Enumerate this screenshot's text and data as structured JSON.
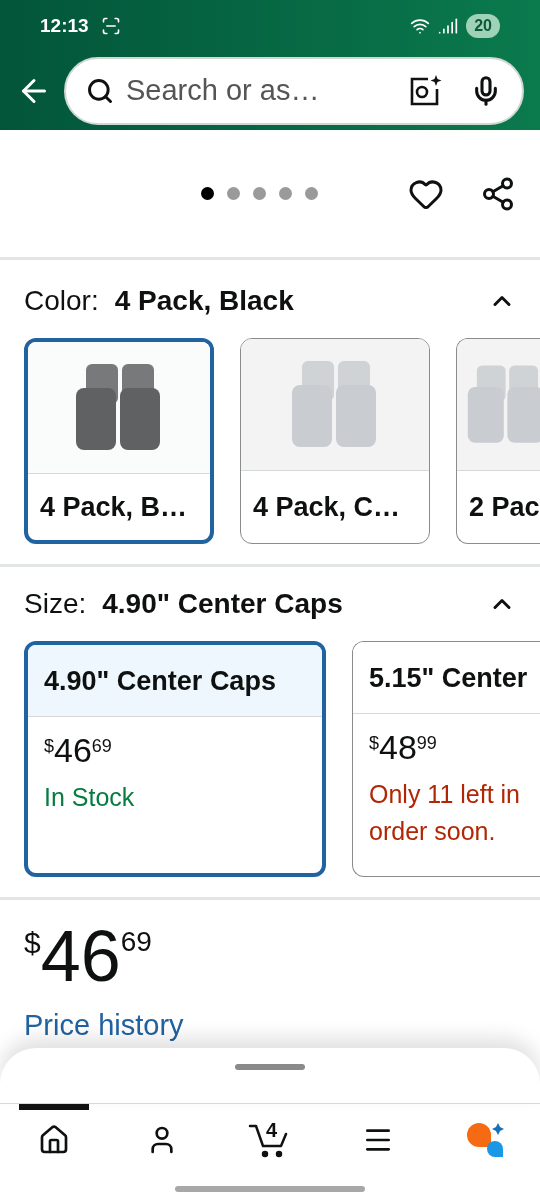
{
  "status_bar": {
    "time": "12:13",
    "battery": "20"
  },
  "search": {
    "placeholder": "Search or as…"
  },
  "carousel": {
    "dots": [
      {
        "selected": true
      },
      {
        "selected": false
      },
      {
        "selected": false
      },
      {
        "selected": false
      },
      {
        "selected": false
      }
    ]
  },
  "color": {
    "label": "Color:",
    "value": "4 Pack, Black",
    "expanded": true,
    "options": [
      {
        "label": "4 Pack, B…",
        "selected": true,
        "kind": "dark"
      },
      {
        "label": "4 Pack, C…",
        "selected": false,
        "kind": "chrome"
      },
      {
        "label": "2 Pac",
        "selected": false,
        "kind": "chrome"
      }
    ]
  },
  "size": {
    "label": "Size:",
    "value": "4.90\" Center Caps",
    "expanded": true,
    "options": [
      {
        "label": "4.90\" Center Caps",
        "selected": true,
        "currency": "$",
        "whole": "46",
        "fraction": "69",
        "kind": "in_stock",
        "availability": [
          "In Stock"
        ]
      },
      {
        "label": "5.15\" Center",
        "selected": false,
        "currency": "$",
        "whole": "48",
        "fraction": "99",
        "kind": "low_stock",
        "availability": [
          "Only 11 left in",
          "order soon."
        ]
      }
    ]
  },
  "price": {
    "currency": "$",
    "whole": "46",
    "fraction": "69",
    "link": "Price history"
  },
  "nav": [
    {
      "kind": "home",
      "selected": true
    },
    {
      "kind": "account",
      "selected": false
    },
    {
      "kind": "cart",
      "selected": false,
      "count": "4"
    },
    {
      "kind": "menu",
      "selected": false
    },
    {
      "kind": "assistant",
      "selected": false
    }
  ]
}
